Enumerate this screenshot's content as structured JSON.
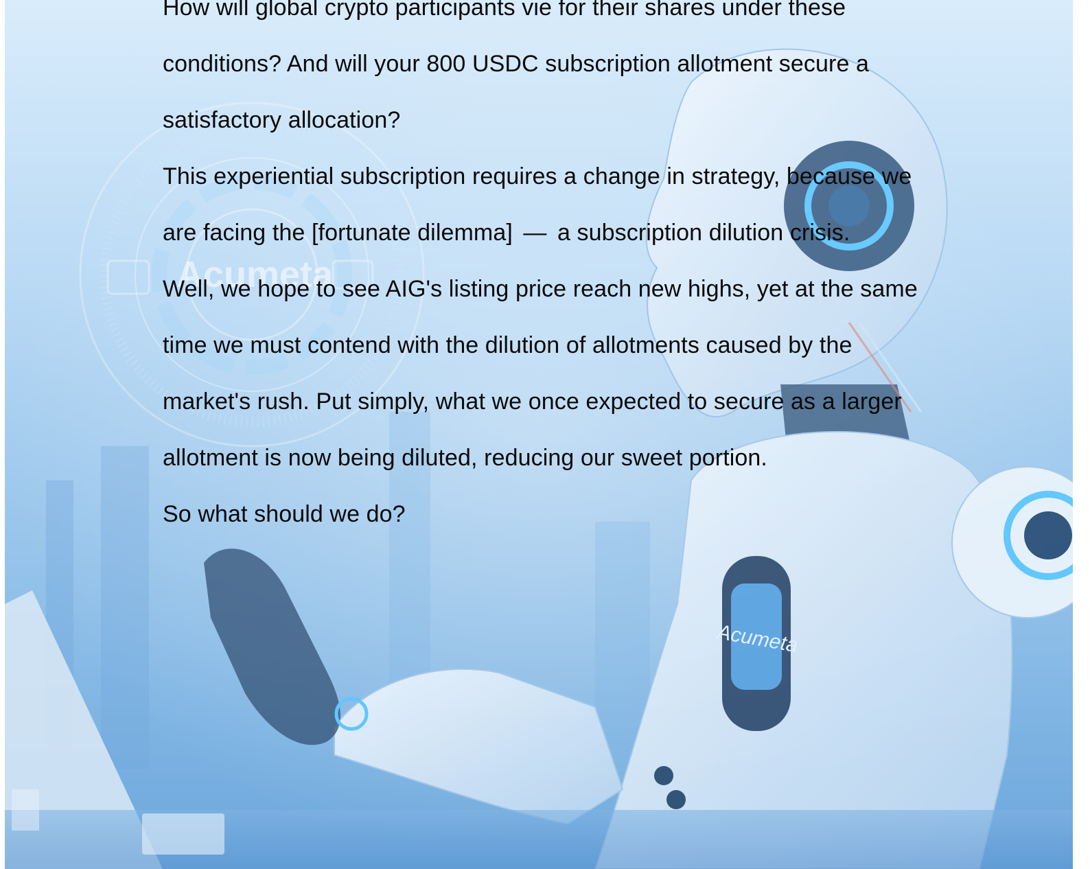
{
  "document": {
    "paragraphs": [
      {
        "id": "p1",
        "text": "How will global crypto participants vie for their shares under these conditions? And will your 800 USDC subscription allotment secure a satisfactory allocation?"
      },
      {
        "id": "p2",
        "before": "This experiential subscription requires a change in strategy, because we are facing the [fortunate dilemma]",
        "dash": "—",
        "after": "a subscription dilution crisis."
      },
      {
        "id": "p3",
        "text": "Well, we hope to see AIG's listing price reach new highs, yet at the same time we must contend with the dilution of allotments caused by the market's rush. Put simply, what we once expected to secure as a larger allotment is now being diluted, reducing our sweet portion."
      },
      {
        "id": "p4",
        "text": "So what should we do?"
      }
    ]
  },
  "background": {
    "logo_text": "Acumeta",
    "chest_badge_text": "Acumeta",
    "colors": {
      "sky_top": "#d9ecfb",
      "sky_bottom": "#6aa6dc",
      "accent_glow": "#5ec8ff",
      "robot_white": "#eef5fc",
      "robot_dark": "#1f3a5c"
    }
  }
}
